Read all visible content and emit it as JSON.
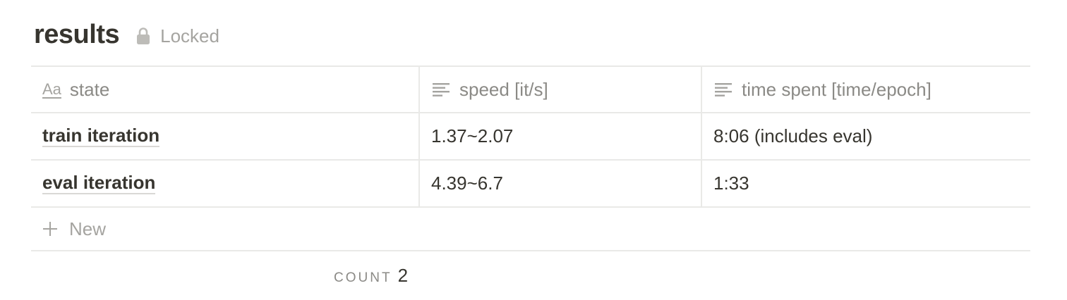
{
  "page": {
    "title": "results",
    "locked_label": "Locked"
  },
  "table": {
    "columns": [
      {
        "label": "state",
        "icon": "title-property-icon"
      },
      {
        "label": "speed [it/s]",
        "icon": "text-property-icon"
      },
      {
        "label": "time spent [time/epoch]",
        "icon": "text-property-icon"
      }
    ],
    "rows": [
      {
        "state": "train iteration",
        "speed": "1.37~2.07",
        "time": "8:06 (includes eval)"
      },
      {
        "state": "eval iteration",
        "speed": "4.39~6.7",
        "time": "1:33"
      }
    ],
    "new_label": "New"
  },
  "footer": {
    "count_label": "COUNT",
    "count_value": "2"
  },
  "colors": {
    "text": "#37352f",
    "muted": "#a5a4a0",
    "border": "#e9e9e7"
  }
}
